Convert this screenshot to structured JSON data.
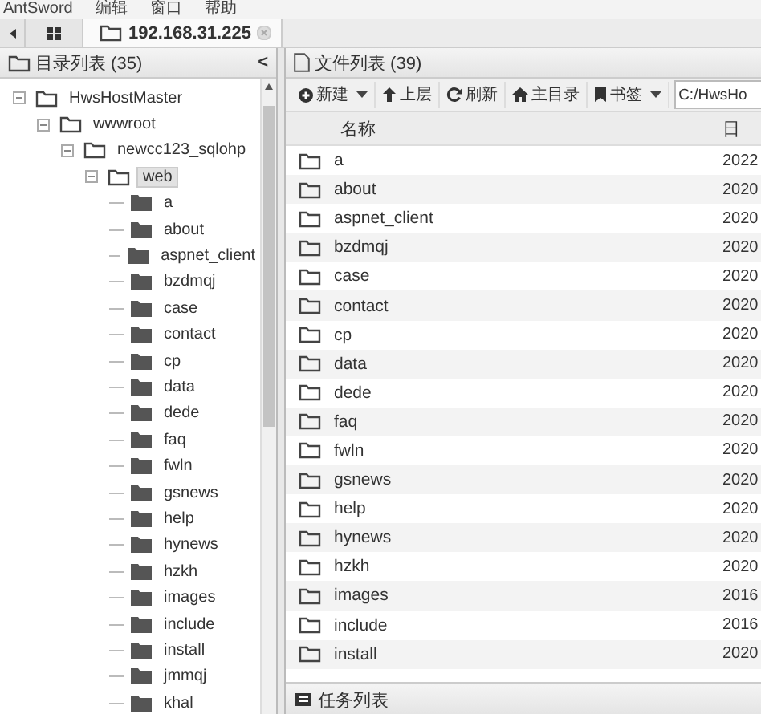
{
  "menu": [
    "AntSword",
    "编辑",
    "窗口",
    "帮助"
  ],
  "tabs": [
    {
      "label": "192.168.31.225",
      "selected": true
    }
  ],
  "dir_panel": {
    "title": "目录列表 (35)",
    "collapse": "<",
    "tree": [
      {
        "label": "HwsHostMaster",
        "expanded": true,
        "selected": false,
        "children": [
          {
            "label": "wwwroot",
            "expanded": true,
            "selected": false,
            "children": [
              {
                "label": "newcc123_sqlohp",
                "expanded": true,
                "selected": false,
                "children": [
                  {
                    "label": "web",
                    "expanded": true,
                    "selected": true,
                    "children": [
                      {
                        "label": "a",
                        "selected": false
                      },
                      {
                        "label": "about",
                        "selected": false
                      },
                      {
                        "label": "aspnet_client",
                        "selected": false
                      },
                      {
                        "label": "bzdmqj",
                        "selected": false
                      },
                      {
                        "label": "case",
                        "selected": false
                      },
                      {
                        "label": "contact",
                        "selected": false
                      },
                      {
                        "label": "cp",
                        "selected": false
                      },
                      {
                        "label": "data",
                        "selected": false
                      },
                      {
                        "label": "dede",
                        "selected": false
                      },
                      {
                        "label": "faq",
                        "selected": false
                      },
                      {
                        "label": "fwln",
                        "selected": false
                      },
                      {
                        "label": "gsnews",
                        "selected": false
                      },
                      {
                        "label": "help",
                        "selected": false
                      },
                      {
                        "label": "hynews",
                        "selected": false
                      },
                      {
                        "label": "hzkh",
                        "selected": false
                      },
                      {
                        "label": "images",
                        "selected": false
                      },
                      {
                        "label": "include",
                        "selected": false
                      },
                      {
                        "label": "install",
                        "selected": false
                      },
                      {
                        "label": "jmmqj",
                        "selected": false
                      },
                      {
                        "label": "khal",
                        "selected": false
                      }
                    ]
                  }
                ]
              }
            ]
          }
        ]
      }
    ]
  },
  "file_panel": {
    "title": "文件列表 (39)",
    "toolbar": [
      {
        "kind": "new",
        "label": "新建",
        "dropdown": true
      },
      {
        "kind": "up",
        "label": "上层",
        "dropdown": false
      },
      {
        "kind": "refresh",
        "label": "刷新",
        "dropdown": false
      },
      {
        "kind": "home",
        "label": "主目录",
        "dropdown": false
      },
      {
        "kind": "bookmark",
        "label": "书签",
        "dropdown": true
      }
    ],
    "path": "C:/HwsHo",
    "columns": [
      "名称",
      "日"
    ],
    "rows": [
      {
        "name": "a",
        "date": "2022"
      },
      {
        "name": "about",
        "date": "2020"
      },
      {
        "name": "aspnet_client",
        "date": "2020"
      },
      {
        "name": "bzdmqj",
        "date": "2020"
      },
      {
        "name": "case",
        "date": "2020"
      },
      {
        "name": "contact",
        "date": "2020"
      },
      {
        "name": "cp",
        "date": "2020"
      },
      {
        "name": "data",
        "date": "2020"
      },
      {
        "name": "dede",
        "date": "2020"
      },
      {
        "name": "faq",
        "date": "2020"
      },
      {
        "name": "fwln",
        "date": "2020"
      },
      {
        "name": "gsnews",
        "date": "2020"
      },
      {
        "name": "help",
        "date": "2020"
      },
      {
        "name": "hynews",
        "date": "2020"
      },
      {
        "name": "hzkh",
        "date": "2020"
      },
      {
        "name": "images",
        "date": "2016"
      },
      {
        "name": "include",
        "date": "2016"
      },
      {
        "name": "install",
        "date": "2020"
      }
    ]
  },
  "task_bar": {
    "title": "任务列表"
  }
}
